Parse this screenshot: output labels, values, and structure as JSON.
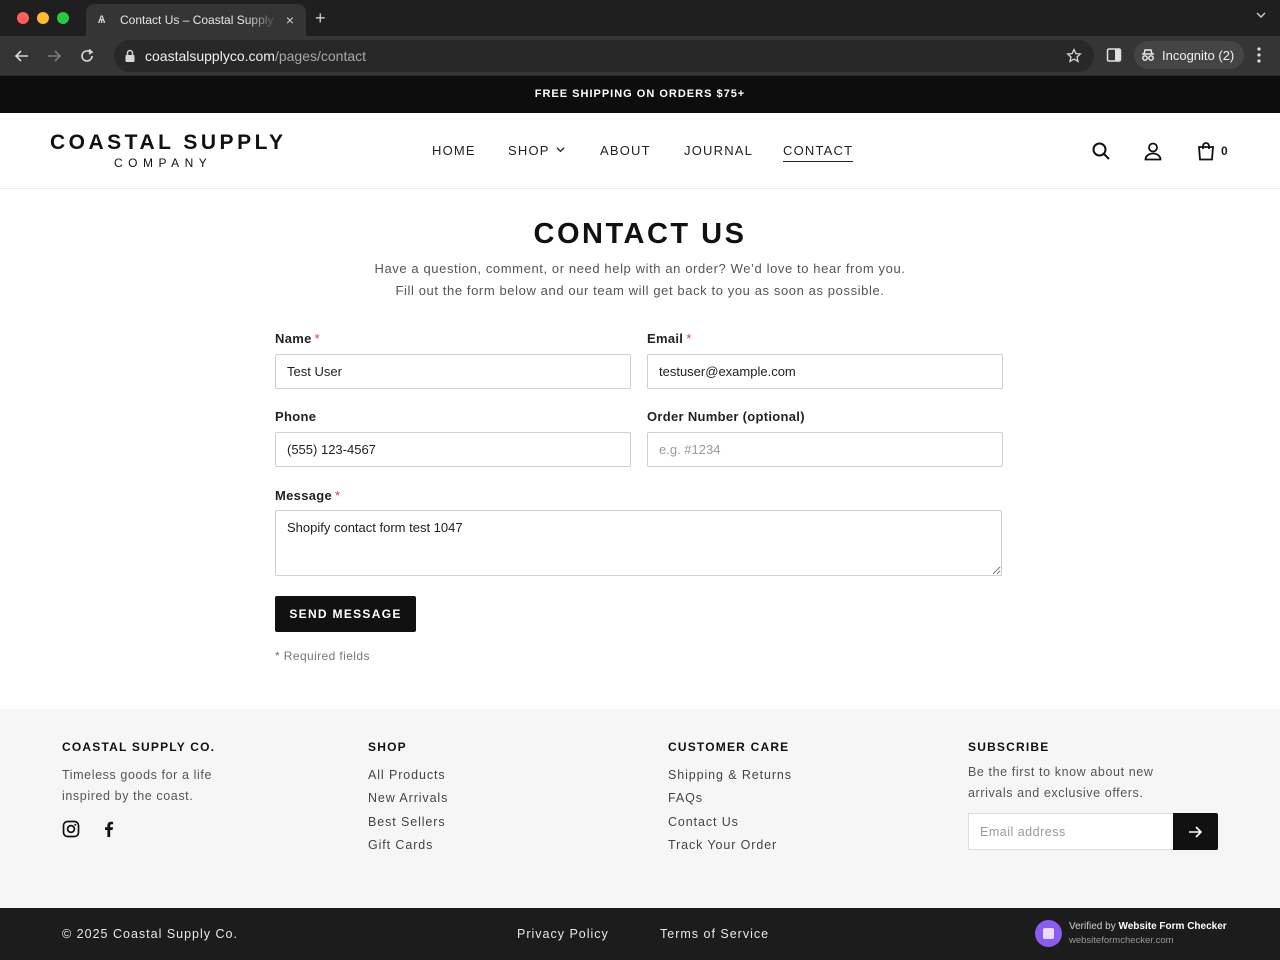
{
  "browser": {
    "tab_title": "Contact Us – Coastal Supply Co.",
    "new_tab": "+",
    "close": "×",
    "url_host": "coastalsupplyco.com",
    "url_path": "/pages/contact",
    "incognito_label": "Incognito (2)"
  },
  "announcement": "FREE SHIPPING ON ORDERS $75+",
  "header": {
    "logo_main": "COASTAL SUPPLY",
    "logo_sub": "COMPANY",
    "nav": [
      "HOME",
      "SHOP",
      "ABOUT",
      "JOURNAL",
      "CONTACT"
    ],
    "active_nav": "CONTACT",
    "cart_count": "0"
  },
  "main": {
    "title": "CONTACT US",
    "intro_line1": "Have a question, comment, or need help with an order? We’d love to hear from you.",
    "intro_line2": "Fill out the form below and our team will get back to you as soon as possible.",
    "form": {
      "name_label": "Name",
      "name_value": "Test User",
      "email_label": "Email",
      "email_value": "testuser@example.com",
      "phone_label": "Phone",
      "phone_value": "(555) 123-4567",
      "order_label": "Order Number (optional)",
      "order_placeholder": "e.g. #1234",
      "message_label": "Message",
      "message_value": "Shopify contact form test 1047",
      "required_mark": "*",
      "submit_label": "SEND MESSAGE",
      "required_note": "* Required fields"
    }
  },
  "footer": {
    "brand_heading": "COASTAL SUPPLY CO.",
    "brand_text_line1": "Timeless goods for a life",
    "brand_text_line2": "inspired by the coast.",
    "shop_heading": "SHOP",
    "shop_links": [
      "All Products",
      "New Arrivals",
      "Best Sellers",
      "Gift Cards"
    ],
    "care_heading": "CUSTOMER CARE",
    "care_links": [
      "Shipping & Returns",
      "FAQs",
      "Contact Us",
      "Track Your Order"
    ],
    "subscribe_heading": "SUBSCRIBE",
    "subscribe_text_line1": "Be the first to know about new",
    "subscribe_text_line2": "arrivals and exclusive offers.",
    "subscribe_placeholder": "Email address",
    "social_icons": [
      "instagram-icon",
      "facebook-icon"
    ]
  },
  "bottom_bar": {
    "copyright": "© 2025 Coastal Supply Co.",
    "privacy": "Privacy Policy",
    "terms": "Terms of Service",
    "badge_prefix": "Verified by",
    "badge_name": "Website Form Checker",
    "badge_url": "websiteformchecker.com"
  },
  "colors": {
    "accent": "#111111",
    "required": "#d23c3c",
    "badge": "#8a5cf0"
  }
}
